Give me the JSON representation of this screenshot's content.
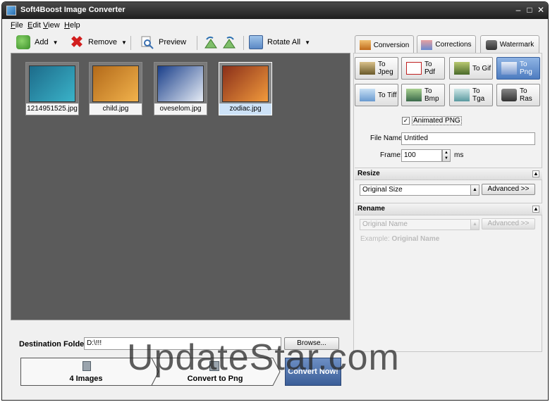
{
  "window": {
    "title": "Soft4Boost Image Converter"
  },
  "menu": [
    "File",
    "Edit",
    "View",
    "Help"
  ],
  "toolbar": {
    "add_label": "Add",
    "remove_label": "Remove",
    "preview_label": "Preview",
    "rotate_all_label": "Rotate All"
  },
  "gallery": {
    "thumbnails": [
      {
        "name": "1214951525.jpg",
        "selected": false,
        "colors": [
          "#1d6b8a",
          "#3ab3c9"
        ]
      },
      {
        "name": "child.jpg",
        "selected": false,
        "colors": [
          "#b36a1a",
          "#f1b24c"
        ]
      },
      {
        "name": "oveselom.jpg",
        "selected": false,
        "colors": [
          "#1a3f8a",
          "#e6ecf5"
        ]
      },
      {
        "name": "zodiac.jpg",
        "selected": true,
        "colors": [
          "#8a2f1a",
          "#f19a3c"
        ]
      }
    ]
  },
  "destination": {
    "label": "Destination Folder:",
    "value": "D:\\!!!",
    "browse_label": "Browse..."
  },
  "steps": {
    "images_count": "4 Images",
    "convert_to": "Convert to Png",
    "convert_now": "Convert Now!"
  },
  "tabs": [
    {
      "label": "Conversion",
      "active": true
    },
    {
      "label": "Corrections",
      "active": false
    },
    {
      "label": "Watermark",
      "active": false
    }
  ],
  "formats": [
    {
      "label": "To Jpeg",
      "lines": [
        "To",
        "Jpeg"
      ],
      "active": false
    },
    {
      "label": "To Pdf",
      "lines": [
        "To Pdf"
      ],
      "active": false
    },
    {
      "label": "To Gif",
      "lines": [
        "To Gif"
      ],
      "active": false
    },
    {
      "label": "To Png",
      "lines": [
        "To Png"
      ],
      "active": true
    },
    {
      "label": "To Tiff",
      "lines": [
        "To Tiff"
      ],
      "active": false
    },
    {
      "label": "To Bmp",
      "lines": [
        "To",
        "Bmp"
      ],
      "active": false
    },
    {
      "label": "To Tga",
      "lines": [
        "To Tga"
      ],
      "active": false
    },
    {
      "label": "To Ras",
      "lines": [
        "To Ras"
      ],
      "active": false
    }
  ],
  "options": {
    "animated_png_label": "Animated PNG",
    "animated_png_checked": true,
    "file_name_label": "File Name:",
    "file_name_value": "Untitled",
    "frame_label": "Frame:",
    "frame_value": "100",
    "frame_unit": "ms"
  },
  "resize": {
    "header": "Resize",
    "mode": "Original Size",
    "advanced_label": "Advanced >>"
  },
  "rename": {
    "header": "Rename",
    "mode": "Original Name",
    "advanced_label": "Advanced >>",
    "example_prefix": "Example:",
    "example_value": "Original Name"
  },
  "watermark_overlay": "UpdateStar.com"
}
